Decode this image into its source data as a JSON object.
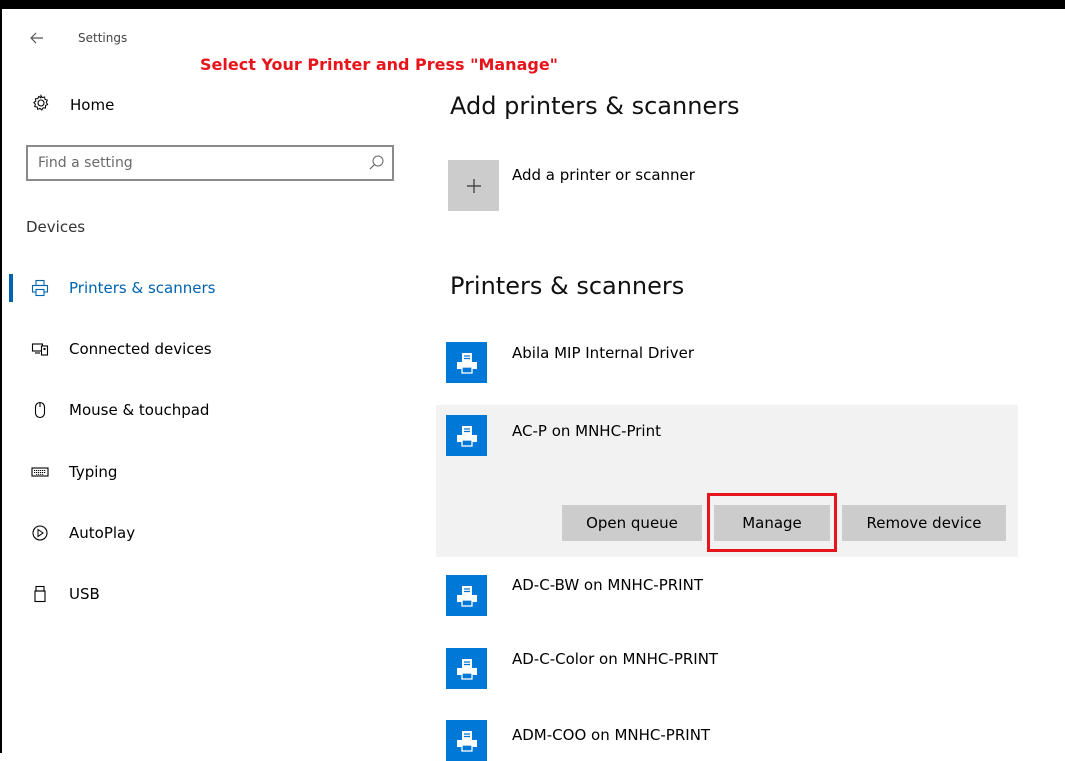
{
  "window": {
    "title": "Settings",
    "annotation": "Select Your Printer and Press \"Manage\""
  },
  "sidebar": {
    "home_label": "Home",
    "search_placeholder": "Find a setting",
    "section_label": "Devices",
    "items": [
      {
        "label": "Printers & scanners",
        "icon": "printer-icon",
        "active": true
      },
      {
        "label": "Connected devices",
        "icon": "connected-devices-icon"
      },
      {
        "label": "Mouse & touchpad",
        "icon": "mouse-icon"
      },
      {
        "label": "Typing",
        "icon": "keyboard-icon"
      },
      {
        "label": "AutoPlay",
        "icon": "autoplay-icon"
      },
      {
        "label": "USB",
        "icon": "usb-icon"
      }
    ]
  },
  "main": {
    "add_heading": "Add printers & scanners",
    "add_label": "Add a printer or scanner",
    "list_heading": "Printers & scanners",
    "printers": [
      {
        "name": "Abila MIP Internal Driver"
      },
      {
        "name": "AC-P on MNHC-Print",
        "selected": true
      },
      {
        "name": "AD-C-BW on MNHC-PRINT"
      },
      {
        "name": "AD-C-Color on MNHC-PRINT"
      },
      {
        "name": "ADM-COO on MNHC-PRINT"
      }
    ],
    "actions": {
      "open_queue": "Open queue",
      "manage": "Manage",
      "remove_device": "Remove device"
    }
  },
  "colors": {
    "accent": "#0078d7",
    "annotation": "#e8141b",
    "selected_bg": "#f2f2f2",
    "button_bg": "#cccccc"
  }
}
